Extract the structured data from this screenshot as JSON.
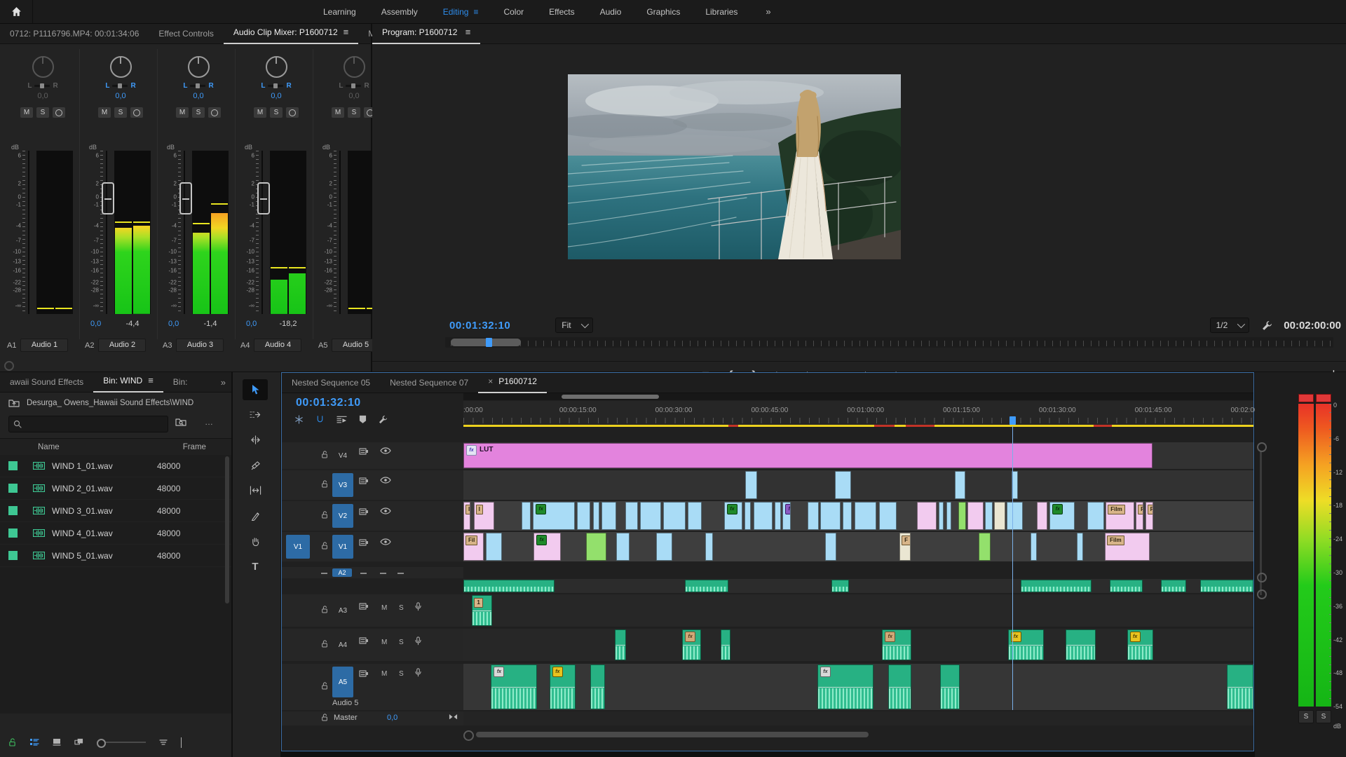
{
  "app": {
    "workspaces": [
      "Learning",
      "Assembly",
      "Editing",
      "Color",
      "Effects",
      "Audio",
      "Graphics",
      "Libraries"
    ],
    "active_workspace": "Editing",
    "overflow": "»"
  },
  "mixer": {
    "tabs": [
      {
        "label": "0712: P1116796.MP4: 00:01:34:06",
        "active": false,
        "menu": false
      },
      {
        "label": "Effect Controls",
        "active": false,
        "menu": false
      },
      {
        "label": "Audio Clip Mixer: P1600712",
        "active": true,
        "menu": true
      },
      {
        "label": "Met",
        "active": false,
        "menu": false
      }
    ],
    "overflow": "»",
    "db_label": "dB",
    "scale": [
      "6",
      "2",
      "0",
      "-1",
      "-4",
      "-7",
      "-10",
      "-13",
      "-16",
      "-22",
      "-28",
      "-∞"
    ],
    "channel_buttons": [
      "M",
      "S"
    ],
    "channels": [
      {
        "id": "A1",
        "name": "Audio 1",
        "pan": "0,0",
        "active": false,
        "fader": false,
        "bars": [
          0,
          0
        ],
        "peaks": [
          3,
          3
        ],
        "volume": "",
        "peak_value": ""
      },
      {
        "id": "A2",
        "name": "Audio 2",
        "pan": "0,0",
        "active": true,
        "fader": true,
        "bars": [
          53,
          54
        ],
        "peaks": [
          56,
          56
        ],
        "volume": "0,0",
        "peak_value": "-4,4"
      },
      {
        "id": "A3",
        "name": "Audio 3",
        "pan": "0,0",
        "active": true,
        "fader": true,
        "bars": [
          50,
          62
        ],
        "peaks": [
          55,
          67
        ],
        "volume": "0,0",
        "peak_value": "-1,4"
      },
      {
        "id": "A4",
        "name": "Audio 4",
        "pan": "0,0",
        "active": true,
        "fader": true,
        "bars": [
          21,
          25
        ],
        "peaks": [
          28,
          28
        ],
        "volume": "0,0",
        "peak_value": "-18,2"
      },
      {
        "id": "A5",
        "name": "Audio 5",
        "pan": "0,0",
        "active": false,
        "fader": false,
        "bars": [
          0,
          0
        ],
        "peaks": [
          3,
          3
        ],
        "volume": "",
        "peak_value": ""
      }
    ]
  },
  "program": {
    "tab": "Program: P1600712",
    "timecode": "00:01:32:10",
    "zoom": "Fit",
    "resolution": "1/2",
    "duration": "00:02:00:00",
    "transport": [
      "marker",
      "mark-in",
      "mark-out",
      "go-to-in",
      "step-back",
      "play",
      "step-forward",
      "go-to-out",
      "lift",
      "extract",
      "export-frame",
      "comparison-view"
    ],
    "add_button": "+"
  },
  "project": {
    "tabs": [
      {
        "label": "awaii Sound Effects",
        "active": false,
        "menu": false
      },
      {
        "label": "Bin: WIND",
        "active": true,
        "menu": true
      },
      {
        "label": "Bin:",
        "active": false,
        "menu": false
      }
    ],
    "overflow": "»",
    "breadcrumb": "Desurga_ Owens_Hawaii Sound Effects\\WIND",
    "search_placeholder": "",
    "columns": [
      "Name",
      "Frame"
    ],
    "items": [
      {
        "name": "WIND 1_01.wav",
        "rate": "48000"
      },
      {
        "name": "WIND 2_01.wav",
        "rate": "48000"
      },
      {
        "name": "WIND 3_01.wav",
        "rate": "48000"
      },
      {
        "name": "WIND 4_01.wav",
        "rate": "48000"
      },
      {
        "name": "WIND 5_01.wav",
        "rate": "48000"
      }
    ],
    "toolbar": [
      "lock-green",
      "list-view",
      "thumbnail-view",
      "freeform-view",
      "zoom-slider",
      "sort",
      "chevron-down"
    ]
  },
  "tools": [
    "selection",
    "track-select",
    "ripple-edit",
    "razor",
    "slip",
    "pen",
    "hand",
    "type"
  ],
  "timeline": {
    "tabs": [
      {
        "label": "Nested Sequence 05",
        "active": false,
        "close": false
      },
      {
        "label": "Nested Sequence 07",
        "active": false,
        "close": false
      },
      {
        "label": "P1600712",
        "active": true,
        "close": true
      }
    ],
    "timecode": "00:01:32:10",
    "toolbar": [
      "linked-selection",
      "snap",
      "timeline-settings",
      "marker",
      "wrench"
    ],
    "ruler_labels": [
      ":00:00",
      "00:00:15:00",
      "00:00:30:00",
      "00:00:45:00",
      "00:01:00:00",
      "00:01:15:00",
      "00:01:30:00",
      "00:01:45:00",
      "00:02:00:00"
    ],
    "video_tracks": [
      {
        "id": "V4",
        "target": false
      },
      {
        "id": "V3",
        "target": true
      },
      {
        "id": "V2",
        "target": true
      },
      {
        "id": "V1",
        "target": true,
        "source": "V1"
      }
    ],
    "audio_tracks": [
      {
        "id": "A2",
        "collapsed": true
      },
      {
        "id": "A3",
        "collapsed": false
      },
      {
        "id": "A4",
        "collapsed": false
      },
      {
        "id": "A5",
        "collapsed": false,
        "target": true,
        "name": "Audio 5"
      }
    ],
    "master": {
      "label": "Master",
      "value": "0,0"
    },
    "playhead_pct": 69.4,
    "work_area_pct": [
      12.4,
      12.4
    ],
    "render_red_segments": [
      [
        33.5,
        1.3
      ],
      [
        52.0,
        2.6
      ],
      [
        56.0,
        3.6
      ],
      [
        79.8,
        2.3
      ]
    ],
    "clips": {
      "v4": [
        {
          "l": 0,
          "w": 87.2,
          "c": "violet",
          "fx": "white",
          "label": "LUT"
        }
      ],
      "v3": [
        {
          "l": 35.7,
          "w": 1.5,
          "c": "blue"
        },
        {
          "l": 47.0,
          "w": 2.1,
          "c": "blue"
        },
        {
          "l": 62.2,
          "w": 1.3,
          "c": "blue"
        },
        {
          "l": 69.4,
          "w": 0.8,
          "c": "blue"
        }
      ],
      "v2": [
        {
          "l": 0,
          "w": 0.9,
          "c": "pink",
          "chip": "I"
        },
        {
          "l": 1.3,
          "w": 2.6,
          "c": "pink",
          "chip": "I"
        },
        {
          "l": 7.4,
          "w": 1.1,
          "c": "blue"
        },
        {
          "l": 8.8,
          "w": 5.3,
          "c": "blue",
          "fx": "green"
        },
        {
          "l": 14.4,
          "w": 1.7,
          "c": "blue"
        },
        {
          "l": 16.4,
          "w": 0.8,
          "c": "blue"
        },
        {
          "l": 17.5,
          "w": 1.8,
          "c": "blue"
        },
        {
          "l": 20.5,
          "w": 1.6,
          "c": "blue"
        },
        {
          "l": 22.4,
          "w": 2.6,
          "c": "blue"
        },
        {
          "l": 25.3,
          "w": 2.8,
          "c": "blue"
        },
        {
          "l": 28.4,
          "w": 1.8,
          "c": "blue"
        },
        {
          "l": 33.0,
          "w": 2.3,
          "c": "blue",
          "fx": "green"
        },
        {
          "l": 35.6,
          "w": 0.8,
          "c": "blue"
        },
        {
          "l": 36.7,
          "w": 2.4,
          "c": "blue"
        },
        {
          "l": 39.4,
          "w": 0.8,
          "c": "blue"
        },
        {
          "l": 40.4,
          "w": 1.0,
          "c": "blue",
          "fx": "purple"
        },
        {
          "l": 43.6,
          "w": 1.4,
          "c": "blue"
        },
        {
          "l": 45.2,
          "w": 2.5,
          "c": "blue"
        },
        {
          "l": 48.0,
          "w": 1.2,
          "c": "blue"
        },
        {
          "l": 49.5,
          "w": 2.8,
          "c": "blue"
        },
        {
          "l": 52.6,
          "w": 2.2,
          "c": "blue"
        },
        {
          "l": 57.4,
          "w": 2.5,
          "c": "pink"
        },
        {
          "l": 60.2,
          "w": 0.6,
          "c": "blue"
        },
        {
          "l": 61.1,
          "w": 0.7,
          "c": "blue"
        },
        {
          "l": 62.6,
          "w": 1.0,
          "c": "green"
        },
        {
          "l": 63.8,
          "w": 2.0,
          "c": "pink"
        },
        {
          "l": 66.0,
          "w": 1.0,
          "c": "blue"
        },
        {
          "l": 67.2,
          "w": 1.4,
          "c": "cream"
        },
        {
          "l": 68.8,
          "w": 2.0,
          "c": "blue"
        },
        {
          "l": 72.6,
          "w": 1.3,
          "c": "pink"
        },
        {
          "l": 74.2,
          "w": 3.2,
          "c": "blue",
          "fx": "green"
        },
        {
          "l": 79.0,
          "w": 2.1,
          "c": "blue"
        },
        {
          "l": 81.3,
          "w": 3.6,
          "c": "pink",
          "chip": "Film"
        },
        {
          "l": 85.1,
          "w": 1.0,
          "c": "pink",
          "chip": "F"
        },
        {
          "l": 86.3,
          "w": 1.0,
          "c": "pink",
          "chip": "F"
        }
      ],
      "v1": [
        {
          "l": 0,
          "w": 2.6,
          "c": "pink",
          "chip": "Fil"
        },
        {
          "l": 2.8,
          "w": 2.1,
          "c": "blue"
        },
        {
          "l": 8.9,
          "w": 3.4,
          "c": "pink",
          "fx": "green"
        },
        {
          "l": 15.5,
          "w": 2.6,
          "c": "green"
        },
        {
          "l": 19.3,
          "w": 1.7,
          "c": "blue"
        },
        {
          "l": 24.4,
          "w": 2.0,
          "c": "blue"
        },
        {
          "l": 30.6,
          "w": 1.0,
          "c": "blue"
        },
        {
          "l": 45.8,
          "w": 1.4,
          "c": "blue"
        },
        {
          "l": 55.2,
          "w": 1.4,
          "c": "cream",
          "chip": "F"
        },
        {
          "l": 65.2,
          "w": 1.5,
          "c": "green"
        },
        {
          "l": 71.8,
          "w": 0.8,
          "c": "blue"
        },
        {
          "l": 77.6,
          "w": 0.8,
          "c": "blue"
        },
        {
          "l": 81.2,
          "w": 5.7,
          "c": "pink",
          "chip": "Film"
        }
      ],
      "a2": [
        {
          "l": 0,
          "w": 11.5
        },
        {
          "l": 28.0,
          "w": 5.5
        },
        {
          "l": 46.6,
          "w": 2.2
        },
        {
          "l": 70.5,
          "w": 9.0
        },
        {
          "l": 81.8,
          "w": 4.2
        },
        {
          "l": 88.3,
          "w": 3.2
        },
        {
          "l": 93.3,
          "w": 6.7
        }
      ],
      "a3": [
        {
          "l": 1.1,
          "w": 2.5,
          "chip": "1"
        }
      ],
      "a4": [
        {
          "l": 19.2,
          "w": 1.4
        },
        {
          "l": 27.7,
          "w": 2.4,
          "fx": "tan"
        },
        {
          "l": 32.6,
          "w": 1.2
        },
        {
          "l": 53.0,
          "w": 3.7,
          "fx": "tan"
        },
        {
          "l": 68.9,
          "w": 4.6,
          "fx": "yellow"
        },
        {
          "l": 76.2,
          "w": 3.8
        },
        {
          "l": 84.0,
          "w": 3.3,
          "fx": "yellow"
        }
      ],
      "a5": [
        {
          "l": 3.5,
          "w": 5.8,
          "fx": "gray"
        },
        {
          "l": 10.9,
          "w": 3.3,
          "fx": "yellow"
        },
        {
          "l": 16.1,
          "w": 1.8
        },
        {
          "l": 44.8,
          "w": 7.1,
          "fx": "gray"
        },
        {
          "l": 53.8,
          "w": 2.9
        },
        {
          "l": 60.3,
          "w": 2.5
        },
        {
          "l": 96.6,
          "w": 3.4
        }
      ]
    }
  },
  "meters": {
    "ticks": [
      "0",
      "-6",
      "-12",
      "-18",
      "-24",
      "-30",
      "-36",
      "-42",
      "-48",
      "-54"
    ],
    "unit": "dB",
    "solo_label": "S"
  }
}
